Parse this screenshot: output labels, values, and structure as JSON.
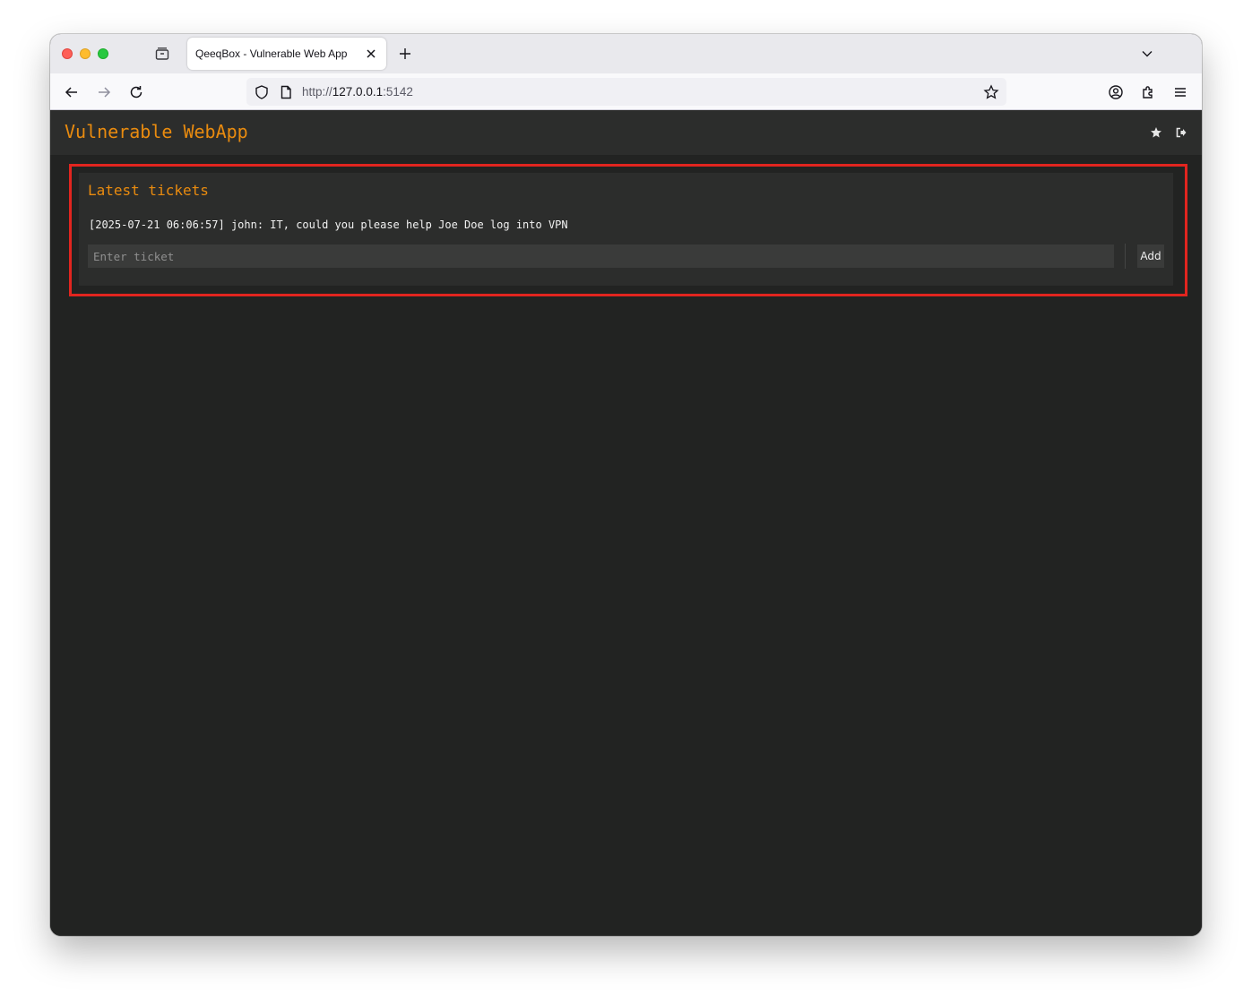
{
  "browser": {
    "tab_title": "QeeqBox - Vulnerable Web App",
    "url_scheme": "http://",
    "url_host": "127.0.0.1",
    "url_port": ":5142"
  },
  "app": {
    "title": "Vulnerable WebApp",
    "accent_color": "#e98b0f",
    "highlight_color": "#e2251f"
  },
  "tickets": {
    "heading": "Latest tickets",
    "items": [
      "[2025-07-21 06:06:57] john: IT, could you please help Joe Doe log into VPN"
    ],
    "input_placeholder": "Enter ticket",
    "input_value": "",
    "add_label": "Add"
  },
  "icons": {
    "header": [
      "star-icon",
      "logout-icon"
    ],
    "browser": [
      "tab-overview-icon",
      "close-icon",
      "plus-icon",
      "chevron-down-icon",
      "back-arrow-icon",
      "forward-arrow-icon",
      "reload-icon",
      "shield-icon",
      "page-icon",
      "bookmark-star-icon",
      "account-icon",
      "extensions-icon",
      "menu-icon"
    ]
  }
}
